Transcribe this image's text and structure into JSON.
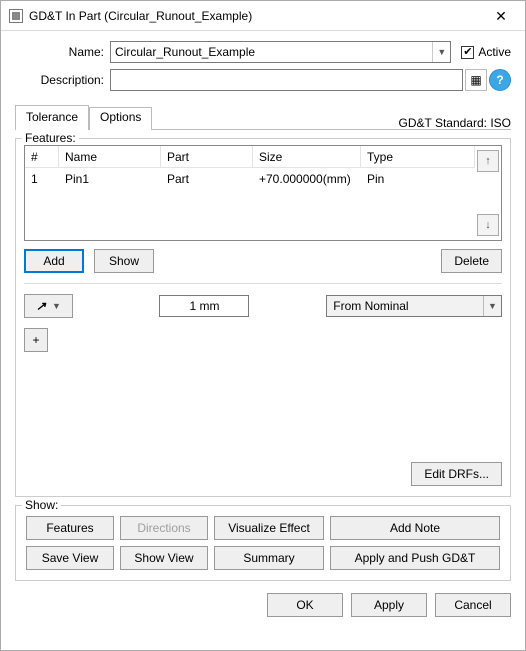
{
  "window": {
    "title": "GD&T In Part (Circular_Runout_Example)"
  },
  "form": {
    "name_label": "Name:",
    "name_value": "Circular_Runout_Example",
    "active_label": "Active",
    "active_checked": true,
    "description_label": "Description:",
    "description_value": ""
  },
  "tabs": {
    "tolerance": "Tolerance",
    "options": "Options",
    "active": "tolerance"
  },
  "standard": {
    "label": "GD&T Standard: ISO"
  },
  "features": {
    "legend": "Features:",
    "columns": {
      "num": "#",
      "name": "Name",
      "part": "Part",
      "size": "Size",
      "type": "Type"
    },
    "rows": [
      {
        "num": "1",
        "name": "Pin1",
        "part": "Part",
        "size": "+70.000000(mm)",
        "type": "Pin"
      }
    ],
    "add": "Add",
    "show": "Show",
    "delete": "Delete"
  },
  "tolerance": {
    "glyph": "↗",
    "value": "1 mm",
    "mode": "From Nominal",
    "plus": "+"
  },
  "edit_drfs": "Edit DRFs...",
  "show_section": {
    "legend": "Show:",
    "features": "Features",
    "directions": "Directions",
    "visualize": "Visualize Effect",
    "add_note": "Add Note",
    "save_view": "Save View",
    "show_view": "Show View",
    "summary": "Summary",
    "apply_push": "Apply and Push GD&T"
  },
  "dialog": {
    "ok": "OK",
    "apply": "Apply",
    "cancel": "Cancel"
  },
  "icons": {
    "settings": "⚙",
    "help": "?"
  }
}
